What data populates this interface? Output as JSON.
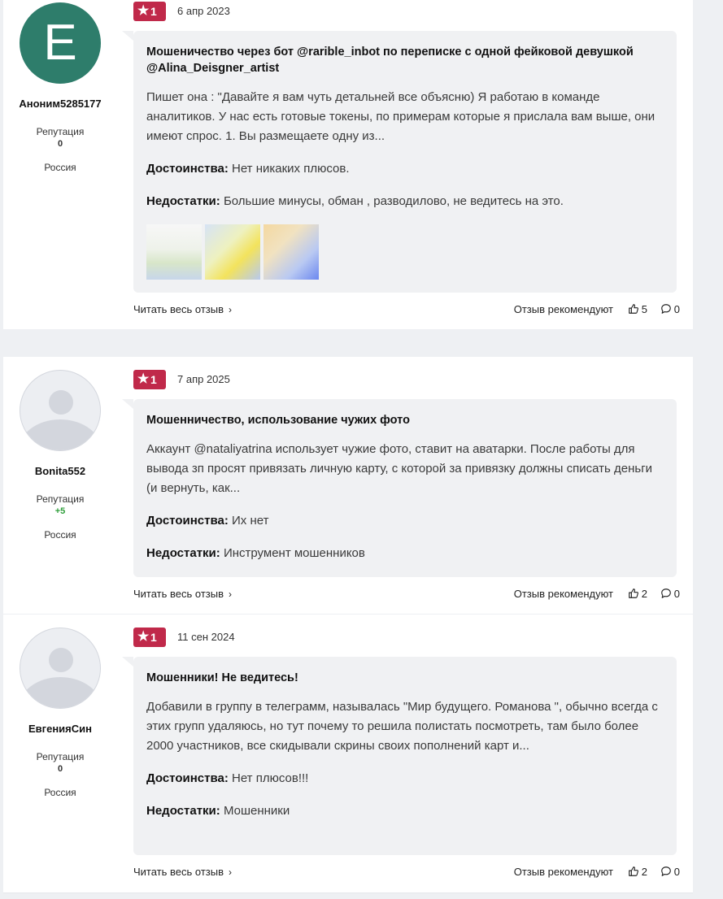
{
  "reviews": [
    {
      "author": {
        "initial": "E",
        "name": "Аноним5285177",
        "reputation_label": "Репутация",
        "reputation": "0",
        "country": "Россия"
      },
      "rating": "1",
      "date": "6 апр 2023",
      "title": "Мошеничество через бот @rarible_inbot по переписке с одной фейковой девушкой @Alina_Deisgner_artist",
      "text": "Пишет она : \"Давайте я вам чуть детальней все объясню) Я работаю в команде аналитиков. У нас есть готовые токены, по примерам которые я прислала вам выше, они имеют спрос. 1. Вы размещаете одну из...",
      "pros_label": "Достоинства:",
      "pros": "Нет никаких плюсов.",
      "cons_label": "Недостатки:",
      "cons": "Большие минусы, обман , разводилово, не ведитесь на это.",
      "read_more": "Читать весь отзыв",
      "recommend_label": "Отзыв рекомендуют",
      "likes": "5",
      "comments": "0"
    },
    {
      "author": {
        "name": "Bonita552",
        "reputation_label": "Репутация",
        "reputation": "+5",
        "country": "Россия"
      },
      "rating": "1",
      "date": "7 апр 2025",
      "title": "Мошенничество, использование чужих фото",
      "text": "Аккаунт @nataliyatrina использует чужие фото, ставит на аватарки. После работы для вывода зп просят привязать личную карту, с которой за привязку должны списать деньги (и вернуть, как...",
      "pros_label": "Достоинства:",
      "pros": "Их нет",
      "cons_label": "Недостатки:",
      "cons": "Инструмент мошенников",
      "read_more": "Читать весь отзыв",
      "recommend_label": "Отзыв рекомендуют",
      "likes": "2",
      "comments": "0"
    },
    {
      "author": {
        "name": "ЕвгенияСин",
        "reputation_label": "Репутация",
        "reputation": "0",
        "country": "Россия"
      },
      "rating": "1",
      "date": "11 сен 2024",
      "title": "Мошенники! Не ведитесь!",
      "text": "Добавили в группу в телеграмм, называлась \"Мир будущего. Романова \", обычно всегда с этих групп удаляюсь, но тут почему то решила полистать посмотреть, там было более 2000 участников, все скидывали скрины своих пополнений карт и...",
      "pros_label": "Достоинства:",
      "pros": "Нет плюсов!!!",
      "cons_label": "Недостатки:",
      "cons": "Мошенники",
      "read_more": "Читать весь отзыв",
      "recommend_label": "Отзыв рекомендуют",
      "likes": "2",
      "comments": "0"
    }
  ],
  "colors": {
    "rating_badge": "#c0294a",
    "avatar_letter_bg": "#2e7d6b",
    "positive_reputation": "#2e9e3a"
  },
  "icons": {
    "star": "star-icon",
    "chevron": "chevron-right-icon",
    "like": "thumbs-up-icon",
    "comment": "comment-icon"
  }
}
